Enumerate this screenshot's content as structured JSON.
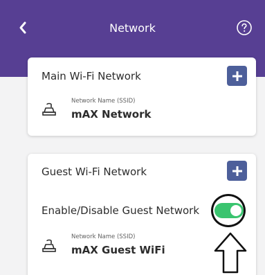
{
  "header": {
    "title": "Network",
    "back_icon": "chevron-left-icon",
    "help_icon": "question-circle-icon",
    "background_color": "#573f93"
  },
  "main_network": {
    "title": "Main Wi-Fi Network",
    "add_icon": "plus-icon",
    "ssid_label": "Network Name (SSID)",
    "ssid_value": "mAX Network",
    "device_icon": "router-icon"
  },
  "guest_network": {
    "title": "Guest Wi-Fi Network",
    "add_icon": "plus-icon",
    "toggle_label": "Enable/Disable Guest Network",
    "toggle_state": "on",
    "toggle_color": "#3ac46f",
    "ssid_label": "Network Name (SSID)",
    "ssid_value": "mAX Guest WiFi",
    "device_icon": "router-icon"
  },
  "annotation": {
    "highlight_icon": "circle-highlight",
    "pointer_icon": "arrow-up-icon"
  }
}
